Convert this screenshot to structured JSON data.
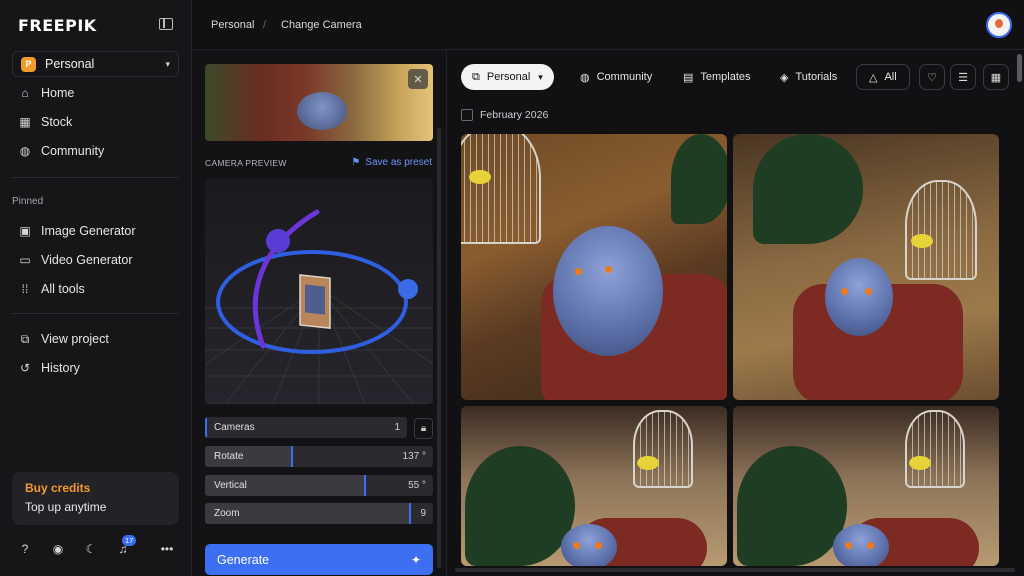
{
  "app": {
    "logo": "FREEPIK"
  },
  "sidebar": {
    "workspace": {
      "badge": "P",
      "label": "Personal"
    },
    "nav": [
      {
        "label": "Home",
        "icon": "home-icon"
      },
      {
        "label": "Stock",
        "icon": "grid-icon"
      },
      {
        "label": "Community",
        "icon": "globe-icon"
      }
    ],
    "pinned_title": "Pinned",
    "pinned": [
      {
        "label": "Image Generator",
        "icon": "image-icon"
      },
      {
        "label": "Video Generator",
        "icon": "video-icon"
      },
      {
        "label": "All tools",
        "icon": "dots-grid-icon"
      }
    ],
    "project": [
      {
        "label": "View project",
        "icon": "copy-icon"
      },
      {
        "label": "History",
        "icon": "history-icon"
      }
    ],
    "credits": {
      "title": "Buy credits",
      "subtitle": "Top up anytime"
    },
    "notifications_count": "17"
  },
  "header": {
    "breadcrumb": [
      "Personal",
      "Change Camera"
    ],
    "separator": "/"
  },
  "camera_panel": {
    "preview_title": "CAMERA PREVIEW",
    "save_preset": "Save as preset",
    "sliders": [
      {
        "label": "Cameras",
        "value": "1",
        "level": 0.0
      },
      {
        "label": "Rotate",
        "value": "137 °",
        "level": 0.38
      },
      {
        "label": "Vertical",
        "value": "55 °",
        "level": 0.7
      },
      {
        "label": "Zoom",
        "value": "9",
        "level": 0.9
      }
    ],
    "generate": "Generate"
  },
  "gallery": {
    "toolbar": {
      "personal": "Personal",
      "community": "Community",
      "templates": "Templates",
      "tutorials": "Tutorials",
      "all": "All"
    },
    "date_label": "February 2026"
  },
  "colors": {
    "accent": "#3d6ff2",
    "credits": "#f39a2b",
    "background": "#111113",
    "sidebar": "#161618"
  }
}
